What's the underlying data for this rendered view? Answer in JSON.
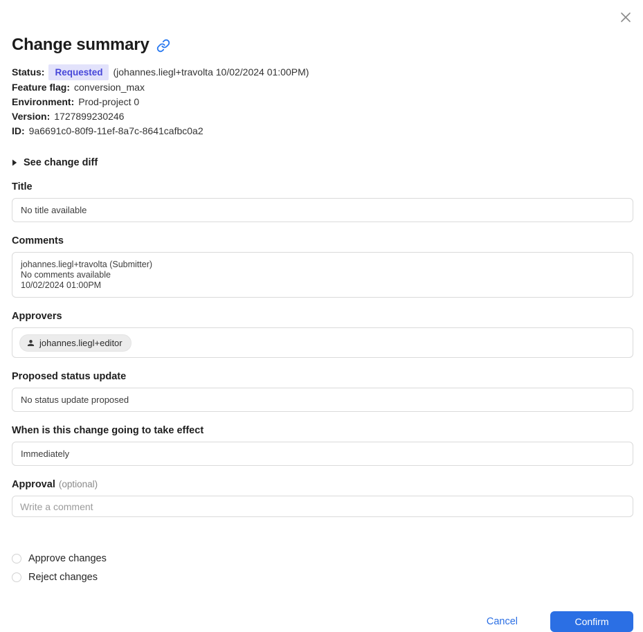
{
  "modal": {
    "title": "Change summary",
    "meta": [
      {
        "label": "Status:",
        "badge": "Requested",
        "suffix": "(johannes.liegl+travolta 10/02/2024 01:00PM)"
      },
      {
        "label": "Feature flag:",
        "value": "conversion_max"
      },
      {
        "label": "Environment:",
        "value": "Prod-project 0"
      },
      {
        "label": "Version:",
        "value": "1727899230246"
      },
      {
        "label": "ID:",
        "value": "9a6691c0-80f9-11ef-8a7c-8641cafbc0a2"
      }
    ],
    "diff_toggle_label": "See change diff",
    "sections": {
      "title": {
        "label": "Title",
        "value": "No title available"
      },
      "comments": {
        "label": "Comments",
        "lines": [
          "johannes.liegl+travolta (Submitter)",
          "No comments available",
          "10/02/2024 01:00PM"
        ]
      },
      "approvers": {
        "label": "Approvers",
        "chip": "johannes.liegl+editor"
      },
      "proposed_status": {
        "label": "Proposed status update",
        "value": "No status update proposed"
      },
      "effect_timing": {
        "label": "When is this change going to take effect",
        "value": "Immediately"
      },
      "approval": {
        "label": "Approval",
        "optional_note": "(optional)",
        "placeholder": "Write a comment",
        "value": ""
      }
    },
    "radios": [
      {
        "label": "Approve changes",
        "checked": false
      },
      {
        "label": "Reject changes",
        "checked": false
      }
    ],
    "footer": {
      "cancel_label": "Cancel",
      "confirm_label": "Confirm"
    },
    "colors": {
      "accent_blue": "#2b6fe4",
      "badge_bg": "#e2e2fb",
      "badge_text": "#4747d9"
    }
  }
}
